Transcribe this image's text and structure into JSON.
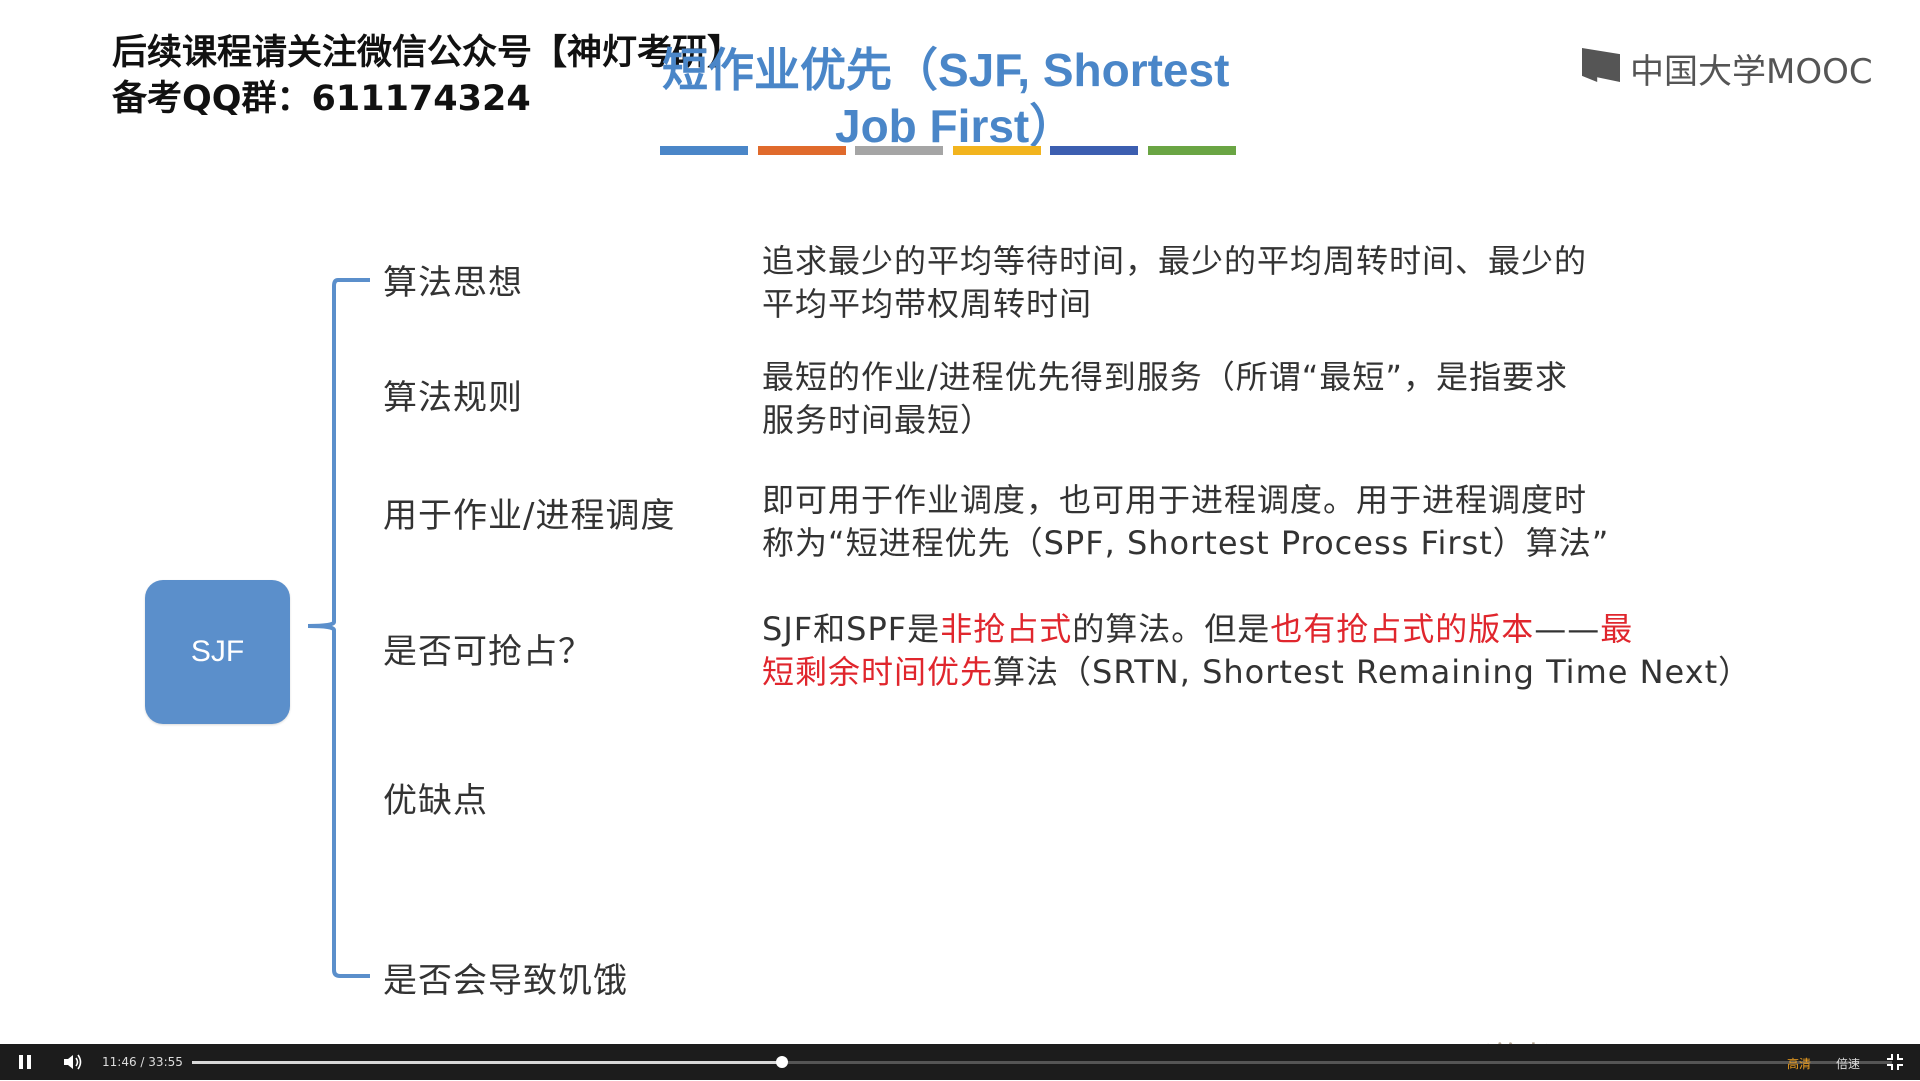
{
  "overlay": {
    "line1": "后续课程请关注微信公众号【神灯考研】",
    "line2": "备考QQ群：611174324"
  },
  "slide": {
    "title_line1": "短作业优先（SJF, Shortest",
    "title_line2": "Job First）",
    "title_bar_colors": [
      "#4a86c8",
      "#e06a2c",
      "#a5a5a5",
      "#f2b41e",
      "#3c5eb0",
      "#6aa544"
    ],
    "logo_text": "中国大学MOOC",
    "center_node": "SJF",
    "rows": [
      {
        "label": "算法思想",
        "desc_line1": "追求最少的平均等待时间，最少的平均周转时间、最少的",
        "desc_line2": "平均平均带权周转时间"
      },
      {
        "label": "算法规则",
        "desc_line1": "最短的作业/进程优先得到服务（所谓“最短”，是指要求",
        "desc_line2": "服务时间最短）"
      },
      {
        "label": "用于作业/进程调度",
        "desc_line1": "即可用于作业调度，也可用于进程调度。用于进程调度时",
        "desc_line2": "称为“短进程优先（SPF, Shortest Process First）算法”"
      },
      {
        "label": "是否可抢占？",
        "desc_seg1": "SJF和SPF是",
        "desc_seg2_red": "非抢占式",
        "desc_seg3": "的算法。但是",
        "desc_seg4_red": "也有抢占式的版本",
        "desc_seg5": "——",
        "desc_seg6_red": "最",
        "desc_line2_red": "短剩余时间优先",
        "desc_line2_rest": "算法（SRTN, Shortest Remaining Time Next）"
      },
      {
        "label": "优缺点"
      },
      {
        "label": "是否会导致饥饿"
      }
    ],
    "red_color": "#e0262d",
    "accent_blue": "#5b8fcb"
  },
  "player": {
    "current_time": "11:46",
    "separator": "/",
    "duration": "33:55",
    "progress_fraction": 0.347,
    "quality_label": "高清",
    "speed_label": "倍速"
  },
  "watermark": "王道考研/CSKAOYAN.COM"
}
